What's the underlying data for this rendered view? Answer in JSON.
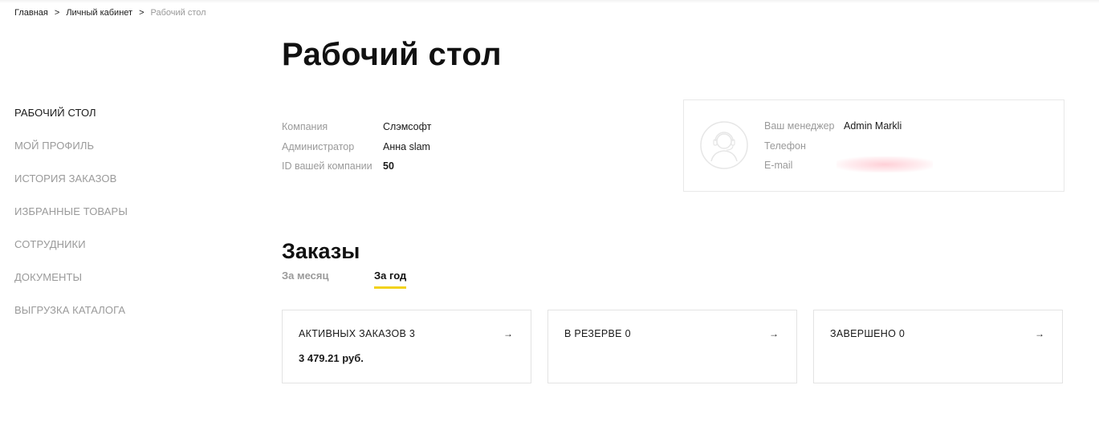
{
  "breadcrumb": {
    "items": [
      "Главная",
      "Личный кабинет"
    ],
    "separator": ">",
    "current": "Рабочий стол"
  },
  "page": {
    "title": "Рабочий стол"
  },
  "sidebar": {
    "items": [
      {
        "label": "Рабочий стол",
        "active": true
      },
      {
        "label": "Мой профиль",
        "active": false
      },
      {
        "label": "История заказов",
        "active": false
      },
      {
        "label": "Избранные товары",
        "active": false
      },
      {
        "label": "Сотрудники",
        "active": false
      },
      {
        "label": "Документы",
        "active": false
      },
      {
        "label": "Выгрузка каталога",
        "active": false
      }
    ]
  },
  "company": {
    "rows": [
      {
        "label": "Компания",
        "value": "Слэмсофт"
      },
      {
        "label": "Администратор",
        "value": "Анна slam"
      },
      {
        "label": "ID вашей компании",
        "value": "50"
      }
    ]
  },
  "manager": {
    "avatar_icon": "support-agent-icon",
    "rows": [
      {
        "label": "Ваш менеджер",
        "value": "Admin Markli"
      },
      {
        "label": "Телефон",
        "value": ""
      },
      {
        "label": "E-mail",
        "value": ""
      }
    ]
  },
  "orders": {
    "title": "Заказы",
    "tabs": [
      {
        "label": "За месяц",
        "active": false
      },
      {
        "label": "За год",
        "active": true
      }
    ],
    "cards": [
      {
        "title": "АКТИВНЫХ ЗАКАЗОВ 3",
        "sum": "3 479.21 руб.",
        "arrow": "→"
      },
      {
        "title": "В РЕЗЕРВЕ 0",
        "sum": "",
        "arrow": "→"
      },
      {
        "title": "ЗАВЕРШЕНО 0",
        "sum": "",
        "arrow": "→"
      }
    ]
  },
  "colors": {
    "accent": "#f2d21b",
    "muted": "#9a9a9a",
    "text": "#1a1a1a",
    "border": "#e3e3e3"
  }
}
